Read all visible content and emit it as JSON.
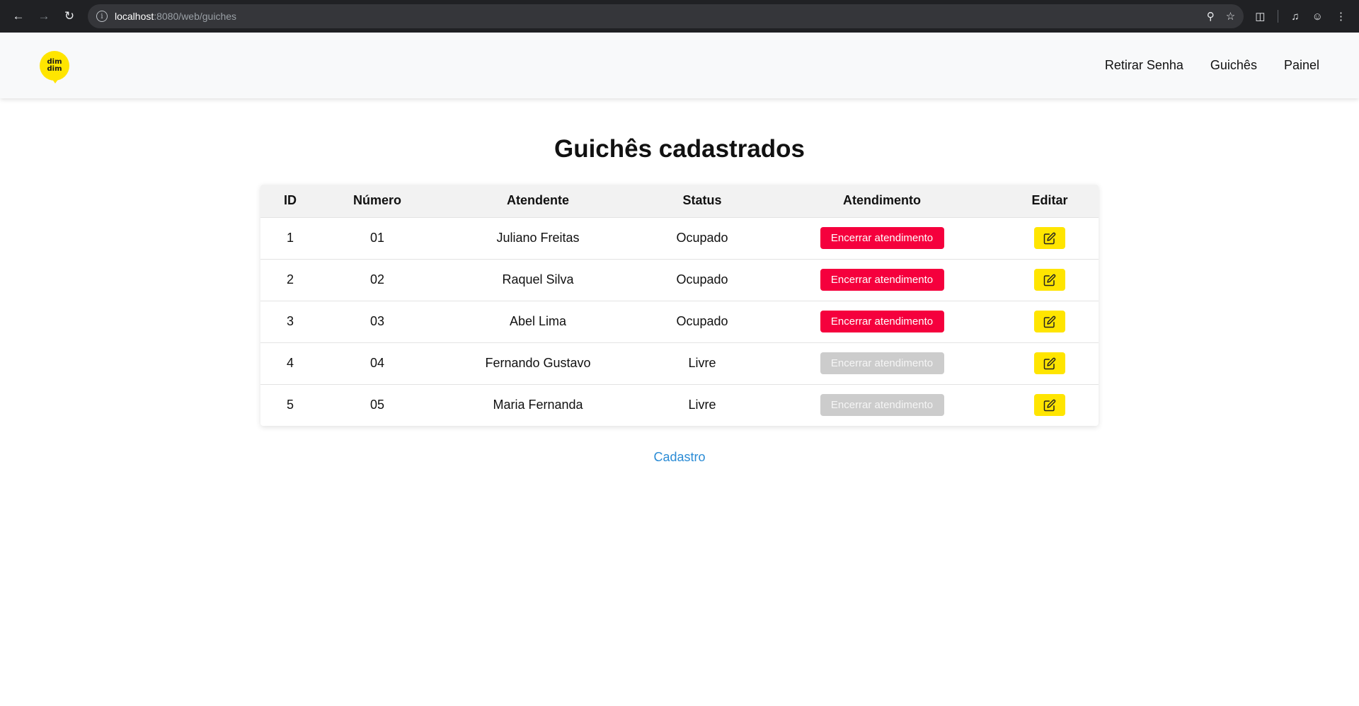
{
  "browser": {
    "url_host": "localhost",
    "url_port_path": ":8080/web/guiches"
  },
  "header": {
    "logo_line1": "dim",
    "logo_line2": "dim",
    "nav": [
      "Retirar Senha",
      "Guichês",
      "Painel"
    ]
  },
  "page": {
    "title": "Guichês cadastrados",
    "columns": [
      "ID",
      "Número",
      "Atendente",
      "Status",
      "Atendimento",
      "Editar"
    ],
    "rows": [
      {
        "id": "1",
        "numero": "01",
        "atendente": "Juliano Freitas",
        "status": "Ocupado",
        "action": "Encerrar atendimento",
        "enabled": true
      },
      {
        "id": "2",
        "numero": "02",
        "atendente": "Raquel Silva",
        "status": "Ocupado",
        "action": "Encerrar atendimento",
        "enabled": true
      },
      {
        "id": "3",
        "numero": "03",
        "atendente": "Abel Lima",
        "status": "Ocupado",
        "action": "Encerrar atendimento",
        "enabled": true
      },
      {
        "id": "4",
        "numero": "04",
        "atendente": "Fernando Gustavo",
        "status": "Livre",
        "action": "Encerrar atendimento",
        "enabled": false
      },
      {
        "id": "5",
        "numero": "05",
        "atendente": "Maria Fernanda",
        "status": "Livre",
        "action": "Encerrar atendimento",
        "enabled": false
      }
    ],
    "link": "Cadastro"
  },
  "colors": {
    "accent_yellow": "#ffe500",
    "danger_red": "#f5003d",
    "disabled_gray": "#cccccc",
    "link_blue": "#2a8bd5"
  },
  "icons": [
    "back-arrow-icon",
    "forward-arrow-icon",
    "reload-icon",
    "info-icon",
    "zoom-icon",
    "star-icon",
    "extensions-icon",
    "media-icon",
    "profile-icon",
    "kebab-menu-icon",
    "edit-icon"
  ]
}
